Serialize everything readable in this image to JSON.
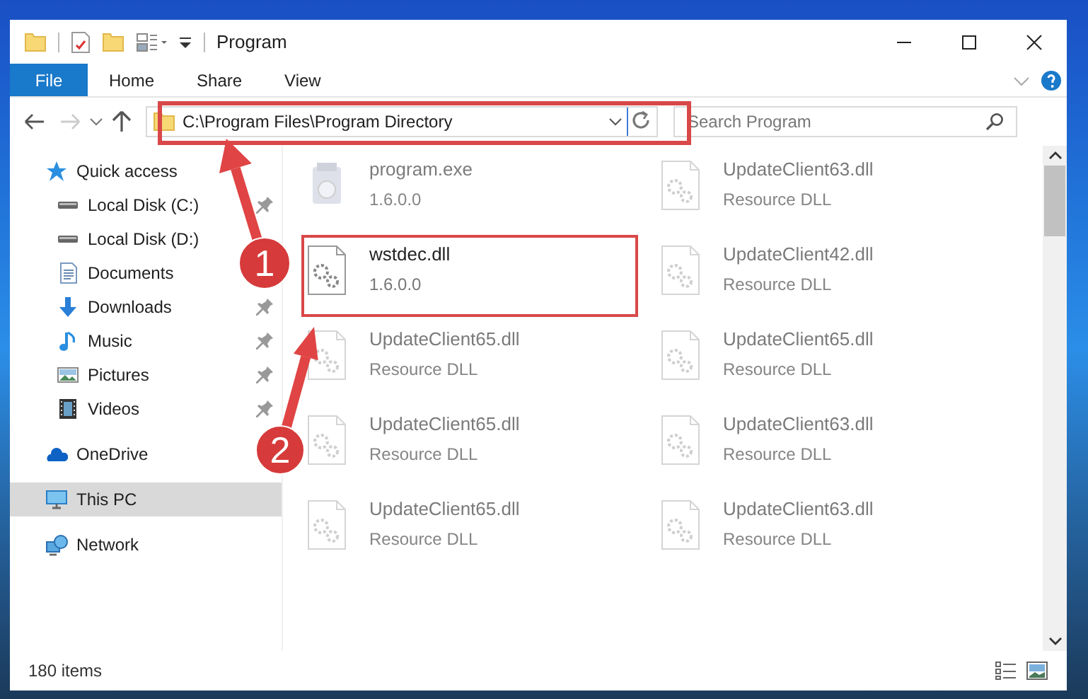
{
  "window": {
    "title": "Program"
  },
  "ribbon": {
    "tabs": [
      {
        "label": "File",
        "selected": true
      },
      {
        "label": "Home",
        "selected": false
      },
      {
        "label": "Share",
        "selected": false
      },
      {
        "label": "View",
        "selected": false
      }
    ]
  },
  "address": {
    "path": "C:\\Program Files\\Program Directory",
    "back_disabled": false,
    "forward_disabled": true
  },
  "search": {
    "placeholder": "Search Program"
  },
  "sidebar": {
    "items": [
      {
        "label": "Quick access",
        "selected": false,
        "children": [
          {
            "label": "Local Disk (C:)",
            "pinned": true,
            "selected": false
          },
          {
            "label": "Local Disk (D:)",
            "pinned": false,
            "selected": false
          },
          {
            "label": "Documents",
            "pinned": false,
            "selected": false
          },
          {
            "label": "Downloads",
            "pinned": true,
            "selected": false
          },
          {
            "label": "Music",
            "pinned": true,
            "selected": false
          },
          {
            "label": "Pictures",
            "pinned": true,
            "selected": false
          },
          {
            "label": "Videos",
            "pinned": true,
            "selected": false
          }
        ]
      },
      {
        "label": "OneDrive",
        "selected": false
      },
      {
        "label": "This PC",
        "selected": true
      },
      {
        "label": "Network",
        "selected": false
      }
    ]
  },
  "files": [
    {
      "name": "program.exe",
      "detail": "1.6.0.0",
      "kind": "exe",
      "faded": true,
      "highlighted": false
    },
    {
      "name": "UpdateClient63.dll",
      "detail": "Resource DLL",
      "kind": "dll",
      "faded": true,
      "highlighted": false
    },
    {
      "name": "wstdec.dll",
      "detail": "1.6.0.0",
      "kind": "dll",
      "faded": false,
      "highlighted": true
    },
    {
      "name": "UpdateClient42.dll",
      "detail": "Resource DLL",
      "kind": "dll",
      "faded": true,
      "highlighted": false
    },
    {
      "name": "UpdateClient65.dll",
      "detail": "Resource DLL",
      "kind": "dll",
      "faded": true,
      "highlighted": false
    },
    {
      "name": "UpdateClient65.dll",
      "detail": "Resource DLL",
      "kind": "dll",
      "faded": true,
      "highlighted": false
    },
    {
      "name": "UpdateClient65.dll",
      "detail": "Resource DLL",
      "kind": "dll",
      "faded": true,
      "highlighted": false
    },
    {
      "name": "UpdateClient63.dll",
      "detail": "Resource DLL",
      "kind": "dll",
      "faded": true,
      "highlighted": false
    },
    {
      "name": "UpdateClient65.dll",
      "detail": "Resource DLL",
      "kind": "dll",
      "faded": true,
      "highlighted": false
    },
    {
      "name": "UpdateClient63.dll",
      "detail": "Resource DLL",
      "kind": "dll",
      "faded": true,
      "highlighted": false
    }
  ],
  "annotations": [
    {
      "number": "1"
    },
    {
      "number": "2"
    }
  ],
  "status_bar": {
    "count": "180 items"
  }
}
